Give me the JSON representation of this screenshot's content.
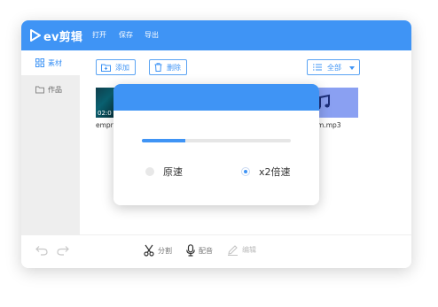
{
  "app": {
    "brand": "ev剪辑",
    "menu": [
      "打开",
      "保存",
      "导出"
    ]
  },
  "sidebar": {
    "items": [
      {
        "label": "素材",
        "icon": "grid-icon",
        "active": true
      },
      {
        "label": "作品",
        "icon": "folder-icon",
        "active": false
      }
    ]
  },
  "toolbar": {
    "add_label": "添加",
    "delete_label": "删除",
    "filter_label": "全部"
  },
  "media": {
    "items": [
      {
        "name": "empr",
        "duration": "02:0"
      },
      {
        "name": "m.mp3"
      }
    ]
  },
  "bottombar": {
    "split_label": "分割",
    "dub_label": "配音",
    "subtitle_label": "编辑"
  },
  "dialog": {
    "progress_fraction": 0.29,
    "option_normal": "原速",
    "option_x2": "x2倍速",
    "selected": "x2倍速"
  },
  "colors": {
    "accent": "#3f94f5",
    "sidebar_bg": "#eeeeee",
    "audio_thumb": "#8aa0f2"
  }
}
